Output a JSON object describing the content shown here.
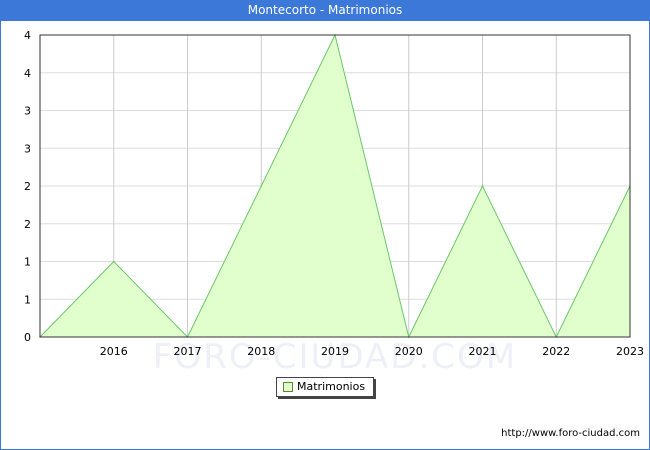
{
  "chart_data": {
    "type": "area",
    "title": "Montecorto - Matrimonios",
    "x_ticks": [
      "2016",
      "2017",
      "2018",
      "2019",
      "2020",
      "2021",
      "2022",
      "2023"
    ],
    "y_ticks": [
      "0",
      "1",
      "1",
      "2",
      "2",
      "3",
      "3",
      "4",
      "4"
    ],
    "ylim": [
      0,
      4
    ],
    "xlim": [
      2015,
      2023
    ],
    "grid": true,
    "legend_placement": "bottom-center",
    "series": [
      {
        "name": "Matrimonios",
        "x": [
          2015,
          2016,
          2017,
          2018,
          2019,
          2020,
          2021,
          2022,
          2023
        ],
        "values": [
          0,
          1,
          0,
          2,
          4,
          0,
          2,
          0,
          2
        ],
        "fill_color": "#e0ffcc",
        "line_color": "#6cc66c"
      }
    ]
  },
  "watermark": "FORO-CIUDAD.COM",
  "footer": {
    "url": "http://www.foro-ciudad.com"
  }
}
